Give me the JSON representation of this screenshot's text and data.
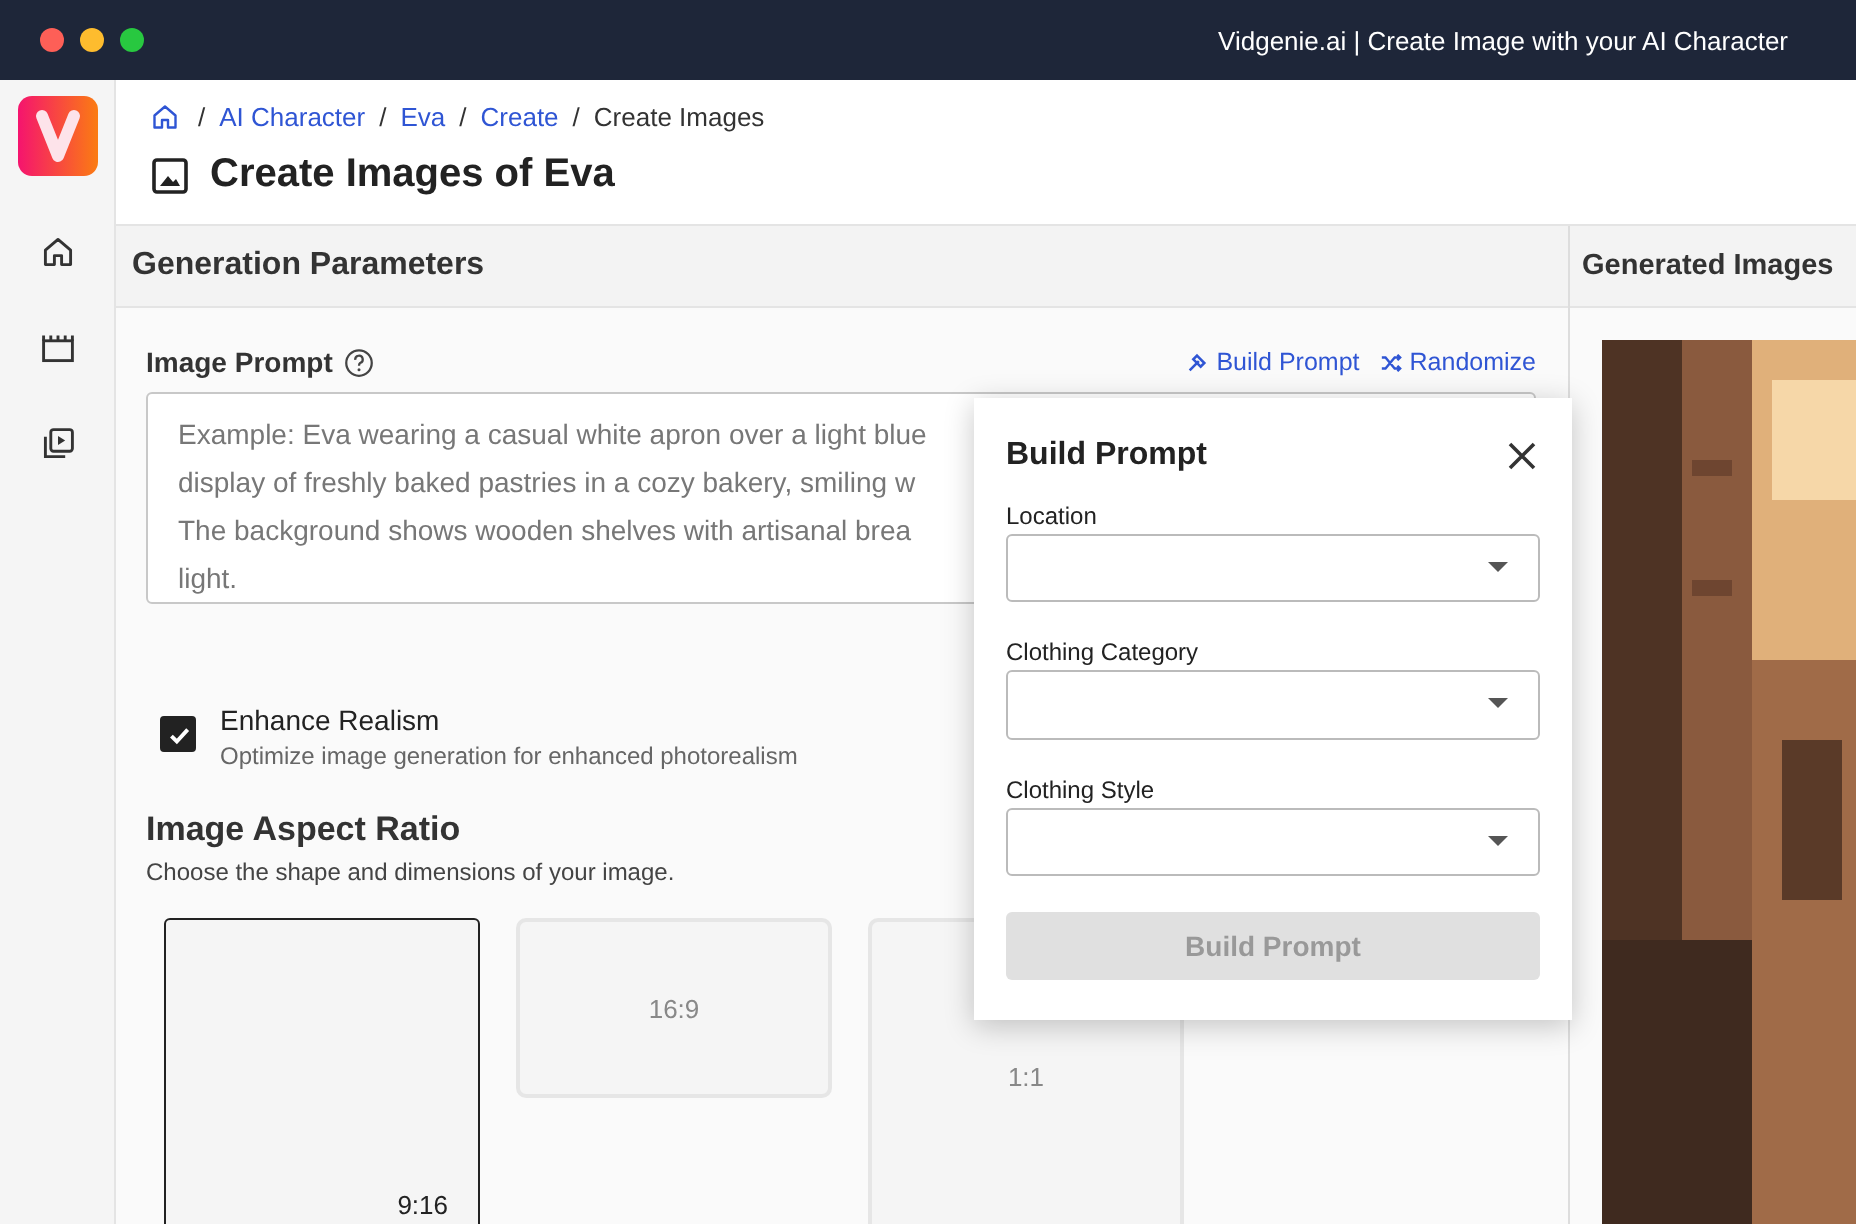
{
  "window": {
    "title": "Vidgenie.ai | Create Image with your AI Character"
  },
  "sidebar": {
    "items": [
      {
        "kind": "home",
        "selected": false
      },
      {
        "kind": "clapper",
        "selected": false
      },
      {
        "kind": "gallery",
        "selected": false
      }
    ]
  },
  "breadcrumb": [
    {
      "separator": "/",
      "label": "AI Character",
      "link": true
    },
    {
      "separator": "/",
      "label": "Eva",
      "link": true
    },
    {
      "separator": "/",
      "label": "Create",
      "link": true
    },
    {
      "separator": "/",
      "label": "Create Images",
      "link": false
    }
  ],
  "page_title": "Create Images of Eva",
  "parameters": {
    "title": "Generation Parameters",
    "prompt": {
      "label": "Image Prompt",
      "actions": [
        {
          "kind": "build",
          "label": "Build Prompt"
        },
        {
          "kind": "random",
          "label": "Randomize"
        }
      ],
      "placeholder_lines": [
        "Example: Eva wearing a casual white apron over a light blue",
        "display of freshly baked pastries in a cozy bakery, smiling w",
        "The background shows wooden shelves with artisanal brea",
        "light."
      ]
    },
    "enhance": {
      "label": "Enhance Realism",
      "description": "Optimize image generation for enhanced photorealism",
      "checked": true
    },
    "aspect": {
      "title": "Image Aspect Ratio",
      "description": "Choose the shape and dimensions of your image.",
      "options": [
        {
          "label": "9:16",
          "kind": "portrait",
          "selected": true
        },
        {
          "label": "16:9",
          "kind": "landscape",
          "selected": false
        },
        {
          "label": "1:1",
          "kind": "square",
          "selected": false
        }
      ]
    }
  },
  "generated": {
    "title": "Generated Images",
    "kind": "picture"
  },
  "popup": {
    "title": "Build Prompt",
    "fields": [
      {
        "label": "Location"
      },
      {
        "label": "Clothing Category"
      },
      {
        "label": "Clothing Style"
      }
    ],
    "button": {
      "label": "Build Prompt",
      "disabled": true
    }
  }
}
